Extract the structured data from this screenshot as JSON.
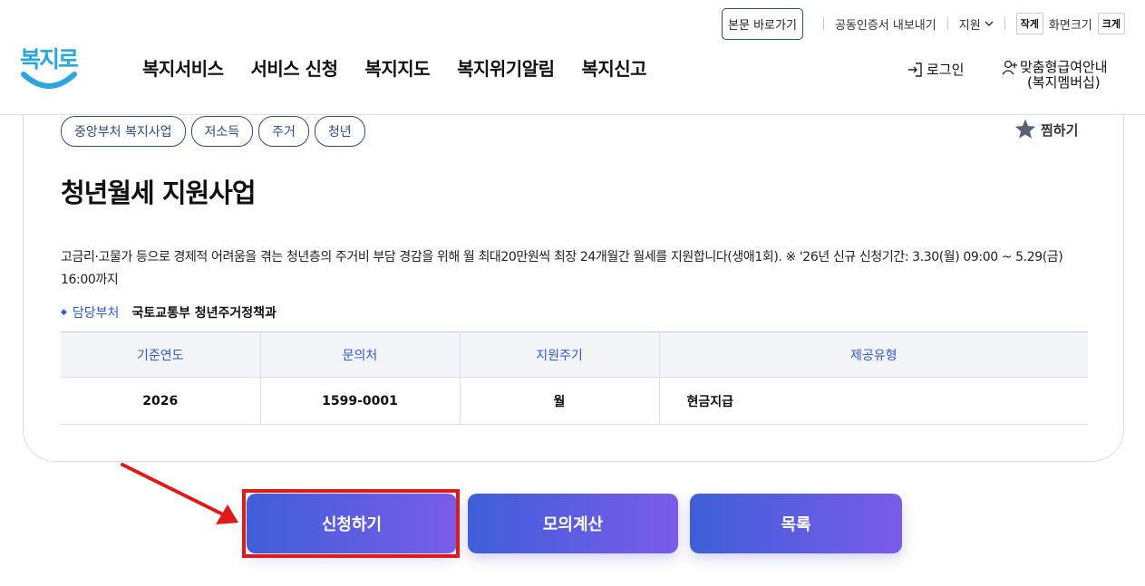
{
  "header": {
    "logo_text": "복지로",
    "nav": [
      "복지서비스",
      "서비스 신청",
      "복지지도",
      "복지위기알림",
      "복지신고"
    ],
    "util": {
      "skip_label": "본문 바로가기",
      "cert_label": "공동인증서 내보내기",
      "support_label": "지원",
      "font_small": "작게",
      "font_label": "화면크기",
      "font_large": "크게"
    },
    "login_label": "로그인",
    "member_label_1": "맞춤형급여안내",
    "member_label_2": "(복지멤버십)"
  },
  "card": {
    "tags": [
      "중앙부처 복지사업",
      "저소득",
      "주거",
      "청년"
    ],
    "favorite_label": "찜하기",
    "title": "청년월세 지원사업",
    "description": "고금리·고물가 등으로 경제적 어려움을 겪는 청년층의 주거비 부담 경감을 위해 월 최대20만원씩 최장 24개월간 월세를 지원합니다(생애1회). ※ '26년 신규 신청기간: 3.30(월) 09:00 ~ 5.29(금) 16:00까지",
    "dept_label": "담당부처",
    "dept_value": "국토교통부 청년주거정책과",
    "table": {
      "headers": [
        "기준연도",
        "문의처",
        "지원주기",
        "제공유형"
      ],
      "row": [
        "2026",
        "1599-0001",
        "월",
        "현금지급"
      ]
    }
  },
  "actions": {
    "apply_label": "신청하기",
    "calc_label": "모의계산",
    "list_label": "목록"
  },
  "colors": {
    "accent": "#2f5ad6",
    "tag_border": "#2f4a8a",
    "button_start": "#3f5ed8",
    "button_end": "#7a5cea",
    "highlight": "#e01919"
  }
}
